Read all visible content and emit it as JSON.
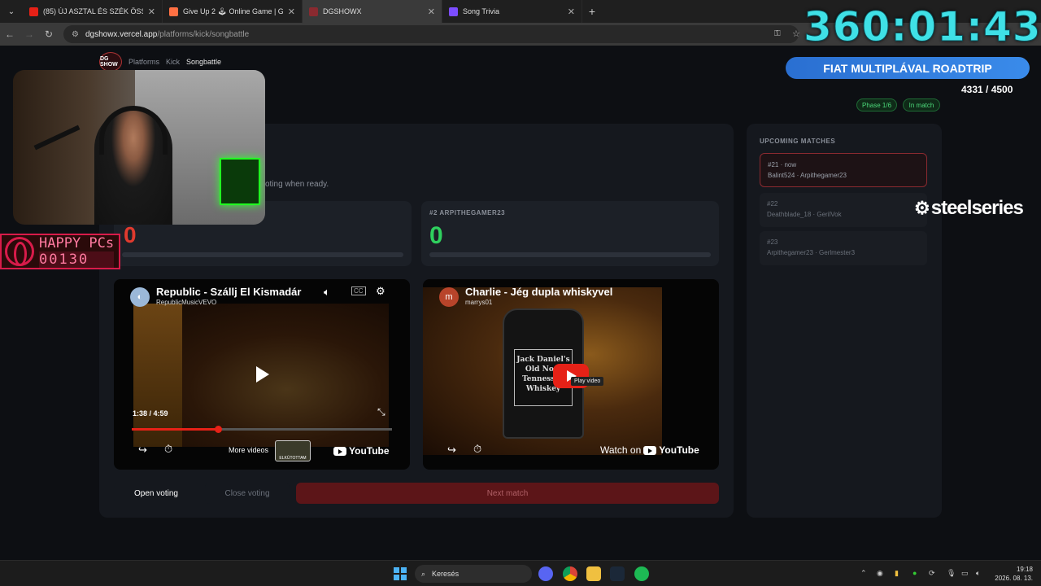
{
  "browser": {
    "tabs": [
      {
        "title": "(85) ÚJ ASZTAL ÉS SZÉK ÖSSZE",
        "color": "#e62117"
      },
      {
        "title": "Give Up 2 🕹 Online Game | Ga",
        "color": "#ff7043"
      },
      {
        "title": "DGSHOWX",
        "color": "#8a2a30"
      },
      {
        "title": "Song Trivia",
        "color": "#7c4dff"
      }
    ],
    "url_host": "dgshowx.vercel.app",
    "url_path": "/platforms/kick/songbattle"
  },
  "overlay": {
    "timer": "360:01:43",
    "banner": "FIAT MULTIPLÁVAL ROADTRIP",
    "goal": "4331 / 4500",
    "sponsor": "steelseries",
    "happypcs_brand": "HAPPY PCs",
    "happypcs_count": "00130",
    "left_score_partial": "0"
  },
  "site": {
    "logo": "DG SHOW",
    "nav": [
      "Platforms",
      "Kick",
      "Songbattle"
    ],
    "phase": "Phase 1/6",
    "status": "In match",
    "hint": "oting when ready."
  },
  "match": {
    "player2_label": "#2 ARPITHEGAMER23",
    "player2_score": "0"
  },
  "videos": [
    {
      "title": "Republic - Szállj El Kismadár",
      "channel": "RepublicMusicVEVO",
      "time": "1:38 / 4:59",
      "progress": 0.33,
      "more_videos": "More videos",
      "thumb_text": "ELKÚTOTTAM",
      "logo": "YouTube"
    },
    {
      "title": "Charlie - Jég dupla whiskyvel",
      "channel": "marrys01",
      "avatar": "m",
      "tooltip": "Play video",
      "watch_on": "Watch on",
      "logo": "YouTube",
      "bottle_text": "Jack Daniel's Old No.7 Tennessee Whiskey"
    }
  ],
  "controls": {
    "open": "Open voting",
    "close": "Close voting",
    "next": "Next match"
  },
  "upcoming": {
    "title": "UPCOMING MATCHES",
    "items": [
      {
        "num": "#21 · now",
        "players": "Balint524 · Arpithegamer23"
      },
      {
        "num": "#22",
        "players": "Deathblade_18 · GerilVok"
      },
      {
        "num": "#23",
        "players": "Arpithegamer23 · Gerlmester3"
      }
    ]
  },
  "taskbar": {
    "search": "Keresés",
    "time": "19:18",
    "date": "2026. 08. 13."
  }
}
